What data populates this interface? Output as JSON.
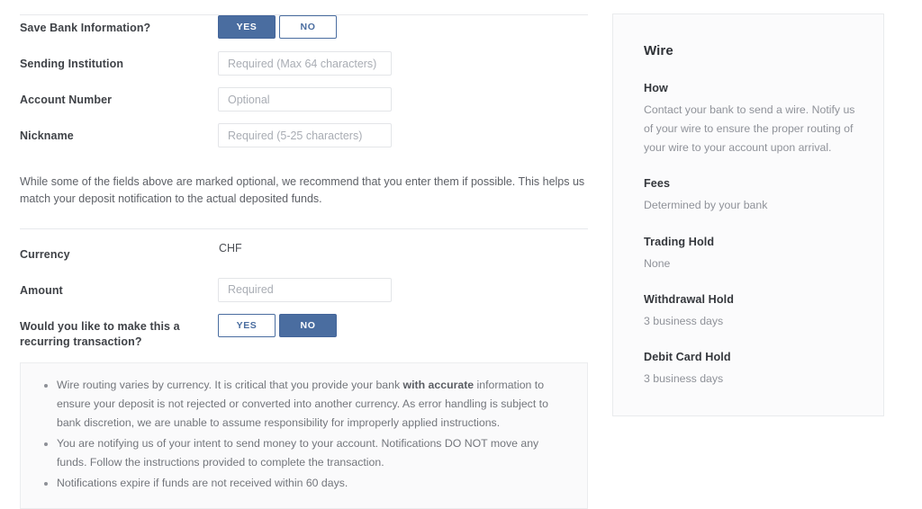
{
  "theme": {
    "accent": "#4a6da0",
    "accent_border": "#44659a",
    "label_color": "#3f4247",
    "muted_text": "#8f9299",
    "panel_bg": "#fbfbfc",
    "panel_border": "#e9ebed",
    "notes_bg": "#fafafb",
    "input_border": "#e3e5e8",
    "divider": "#e7e9ec"
  },
  "form": {
    "rows": [
      {
        "label": "Save Bank Information?",
        "control": "toggle",
        "options": [
          "YES",
          "NO"
        ],
        "selected": "YES"
      },
      {
        "label": "Sending Institution",
        "control": "input",
        "value": "",
        "placeholder": "Required (Max 64 characters)"
      },
      {
        "label": "Account Number",
        "control": "input",
        "value": "",
        "placeholder": "Optional"
      },
      {
        "label": "Nickname",
        "control": "input",
        "value": "",
        "placeholder": "Required (5-25 characters)"
      }
    ],
    "helper_note": "While some of the fields above are marked optional, we recommend that you enter them if possible. This helps us match your deposit notification to the actual deposited funds.",
    "rows2": [
      {
        "label": "Currency",
        "control": "static",
        "value": "CHF"
      },
      {
        "label": "Amount",
        "control": "input",
        "value": "",
        "placeholder": "Required"
      },
      {
        "label": "Would you like to make this a recurring transaction?",
        "control": "toggle",
        "options": [
          "YES",
          "NO"
        ],
        "selected": "NO"
      }
    ]
  },
  "notes": {
    "items": [
      {
        "pre": "Wire routing varies by currency. It is critical that you provide your bank ",
        "bold": "with accurate",
        "post": " information to ensure your deposit is not rejected or converted into another currency. As error handling is subject to bank discretion, we are unable to assume responsibility for improperly applied instructions."
      },
      {
        "pre": "You are notifying us of your intent to send money to your account. Notifications DO NOT move any funds. Follow the instructions provided to complete the transaction.",
        "bold": "",
        "post": ""
      },
      {
        "pre": "Notifications expire if funds are not received within 60 days.",
        "bold": "",
        "post": ""
      }
    ]
  },
  "info_card": {
    "title": "Wire",
    "blocks": [
      {
        "term": "How",
        "desc": "Contact your bank to send a wire. Notify us of your wire to ensure the proper routing of your wire to your account upon arrival."
      },
      {
        "term": "Fees",
        "desc": "Determined by your bank"
      },
      {
        "term": "Trading Hold",
        "desc": "None"
      },
      {
        "term": "Withdrawal Hold",
        "desc": "3 business days"
      },
      {
        "term": "Debit Card Hold",
        "desc": "3 business days"
      }
    ]
  }
}
